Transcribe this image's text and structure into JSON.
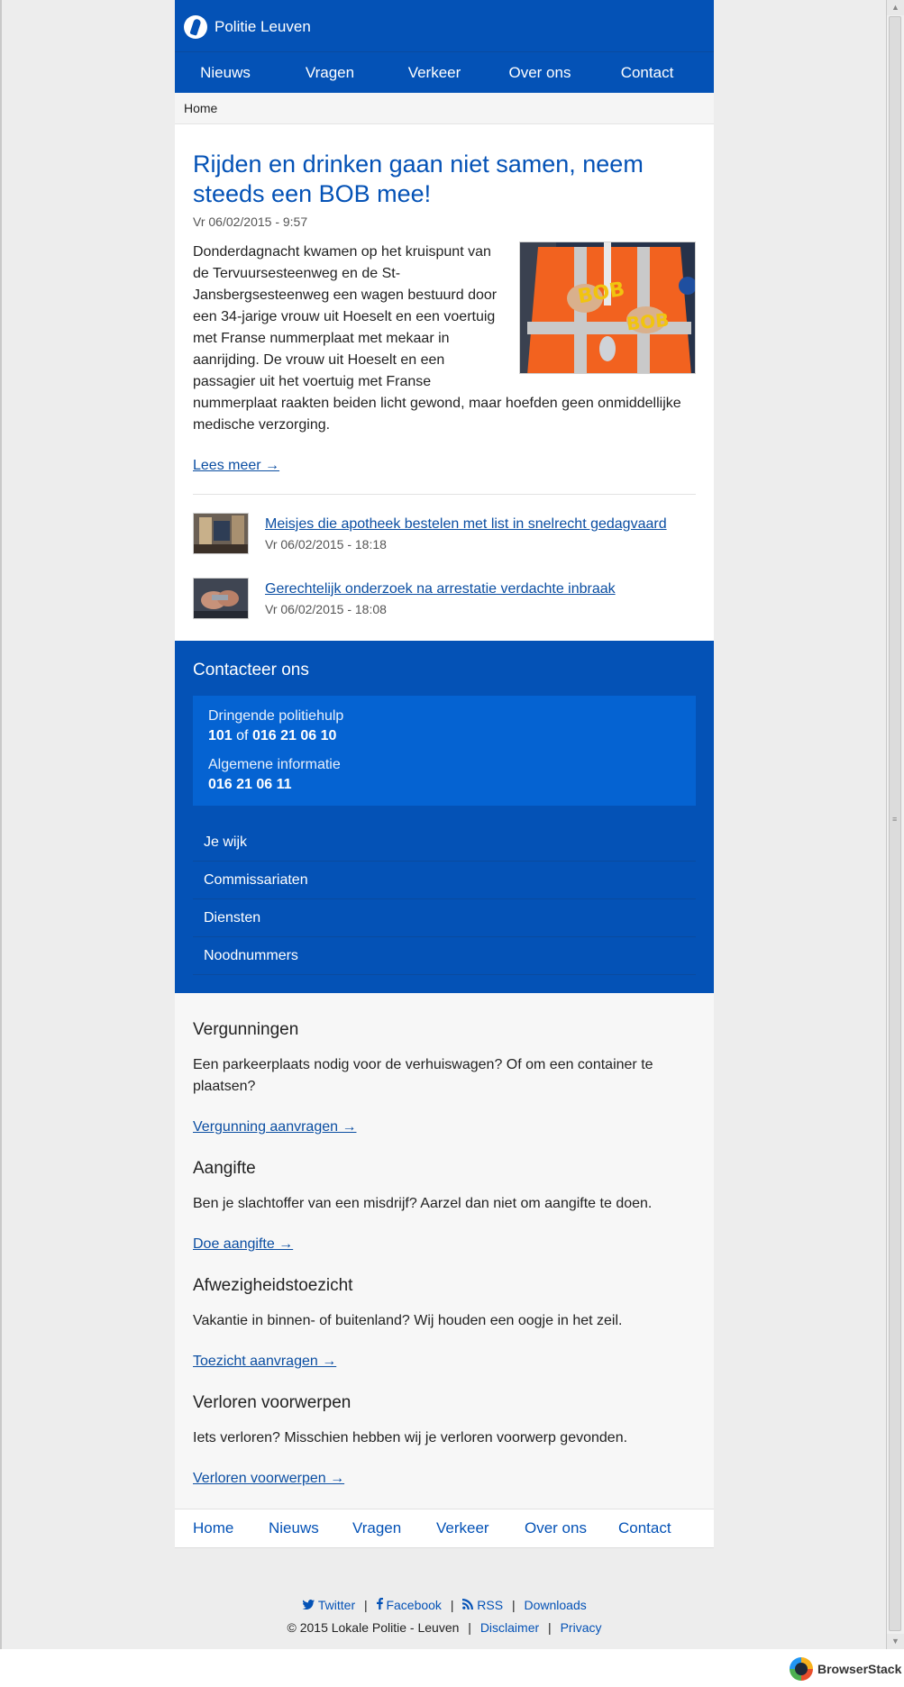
{
  "site": {
    "name": "Politie Leuven"
  },
  "nav": {
    "items": [
      "Nieuws",
      "Vragen",
      "Verkeer",
      "Over ons",
      "Contact"
    ]
  },
  "breadcrumb": {
    "home": "Home"
  },
  "article": {
    "title": "Rijden en drinken gaan niet samen, neem steeds een BOB mee!",
    "date": "Vr 06/02/2015 - 9:57",
    "body": "Donderdagnacht kwamen op het kruispunt van de Tervuursesteenweg en de St-Jansbergsesteenweg een wagen bestuurd door een 34-jarige vrouw uit Hoeselt en een voertuig met Franse nummerplaat met mekaar in aanrijding. De vrouw uit Hoeselt en een passagier uit het voertuig met Franse nummerplaat raakten beiden licht gewond, maar hoefden geen onmiddellijke medische verzorging.",
    "read_more": "Lees meer →",
    "image_badge": "BOB"
  },
  "news": [
    {
      "title": "Meisjes die apotheek bestelen met list in snelrecht gedagvaard",
      "date": "Vr 06/02/2015 - 18:18"
    },
    {
      "title": "Gerechtelijk onderzoek na arrestatie verdachte inbraak",
      "date": "Vr 06/02/2015 - 18:08"
    }
  ],
  "contact": {
    "title": "Contacteer ons",
    "urgent_label": "Dringende politiehulp",
    "urgent_number_1": "101",
    "urgent_or": "of",
    "urgent_number_2": "016 21 06 10",
    "general_label": "Algemene informatie",
    "general_number": "016 21 06 11",
    "links": [
      "Je wijk",
      "Commissariaten",
      "Diensten",
      "Noodnummers"
    ]
  },
  "services": [
    {
      "title": "Vergunningen",
      "text": "Een parkeerplaats nodig voor de verhuiswagen? Of om een container te plaatsen?",
      "link": "Vergunning aanvragen →"
    },
    {
      "title": "Aangifte",
      "text": "Ben je slachtoffer van een misdrijf? Aarzel dan niet om aangifte te doen.",
      "link": "Doe aangifte →"
    },
    {
      "title": "Afwezigheidstoezicht",
      "text": "Vakantie in binnen- of buitenland? Wij houden een oogje in het zeil.",
      "link": "Toezicht aanvragen →"
    },
    {
      "title": "Verloren voorwerpen",
      "text": "Iets verloren? Misschien hebben wij je verloren voorwerp gevonden.",
      "link": "Verloren voorwerpen →"
    }
  ],
  "footer_nav": {
    "items": [
      "Home",
      "Nieuws",
      "Vragen",
      "Verkeer",
      "Over ons",
      "Contact"
    ]
  },
  "footer_meta": {
    "twitter": "Twitter",
    "facebook": "Facebook",
    "rss": "RSS",
    "downloads": "Downloads",
    "copyright": "© 2015 Lokale Politie - Leuven",
    "disclaimer": "Disclaimer",
    "privacy": "Privacy",
    "separator": "|"
  },
  "browserstack": {
    "label": "BrowserStack"
  },
  "colors": {
    "brand_blue": "#0452b6",
    "contact_box": "#0563d2",
    "link": "#0b4ea2"
  },
  "icons": [
    "politie-logo-icon",
    "twitter-icon",
    "facebook-icon",
    "rss-icon",
    "browserstack-icon"
  ]
}
